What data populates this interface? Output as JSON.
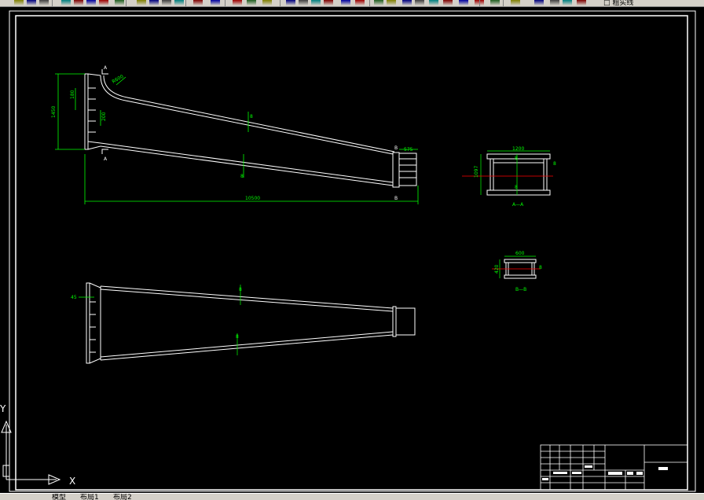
{
  "toolbar": {
    "layer_name": "□ 粗实线",
    "icons": [
      "open-icon",
      "save-icon",
      "print-icon",
      "undo-icon",
      "redo-icon",
      "cut-icon",
      "copy-icon",
      "paste-icon",
      "match-properties-icon",
      "pan-icon",
      "zoom-realtime-icon",
      "zoom-window-icon",
      "zoom-previous-icon",
      "properties-icon",
      "design-center-icon",
      "text-style-icon",
      "dimension-style-icon",
      "table-icon",
      "help-icon",
      "layer-icon"
    ]
  },
  "tabs": {
    "model": "模型",
    "layout1": "布局1",
    "layout2": "布局2"
  },
  "ucs": {
    "x_label": "X",
    "y_label": "Y"
  },
  "elevation": {
    "height": "1450",
    "dim_upper": "180",
    "dim_lower": "200",
    "radius": "R600",
    "length": "10500",
    "end_width": "575",
    "section_mark_top": "A",
    "section_mark_bottom": "A",
    "end_mark_top": "B",
    "end_mark_bottom": "B",
    "upper_flange_mark": "8",
    "lower_flange_mark": "8"
  },
  "plan": {
    "root_dim": "45",
    "upper_mark": "8",
    "lower_mark": "8"
  },
  "section_aa": {
    "width": "1200",
    "height": "1097",
    "top_mark": "8",
    "bottom_mark": "8",
    "side_mark": "8",
    "caption": "A—A"
  },
  "section_bb": {
    "width": "600",
    "height": "420",
    "side_mark": "8",
    "caption": "B—B"
  }
}
